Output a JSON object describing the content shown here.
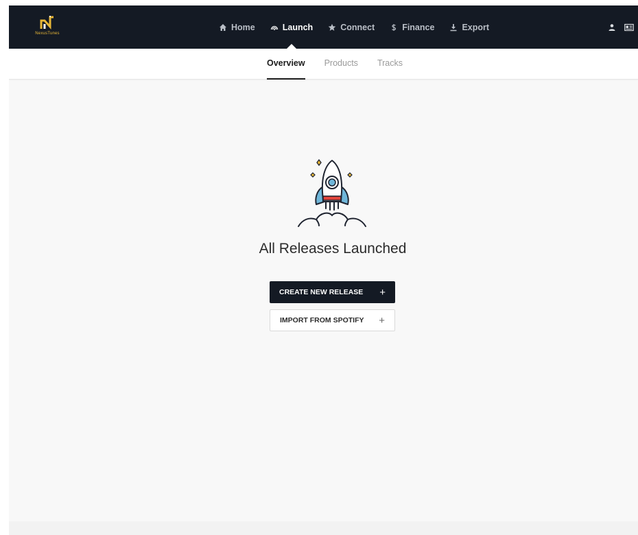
{
  "brand": {
    "logo_text": "NexusTunes",
    "accent_color": "#e8b737",
    "topbar_color": "#141a24"
  },
  "nav": {
    "items": [
      {
        "label": "Home",
        "icon": "home-icon"
      },
      {
        "label": "Launch",
        "icon": "rocket-launch-icon",
        "active": true
      },
      {
        "label": "Connect",
        "icon": "star-icon"
      },
      {
        "label": "Finance",
        "icon": "dollar-icon"
      },
      {
        "label": "Export",
        "icon": "download-icon"
      }
    ],
    "right_icons": [
      "user-icon",
      "id-card-icon"
    ]
  },
  "subtabs": {
    "items": [
      {
        "label": "Overview",
        "active": true
      },
      {
        "label": "Products"
      },
      {
        "label": "Tracks"
      }
    ]
  },
  "empty_state": {
    "illustration": "rocket-launch-illustration",
    "title": "All Releases Launched",
    "primary_button": "CREATE NEW RELEASE",
    "secondary_button": "IMPORT FROM SPOTIFY",
    "plus_symbol": "+"
  }
}
